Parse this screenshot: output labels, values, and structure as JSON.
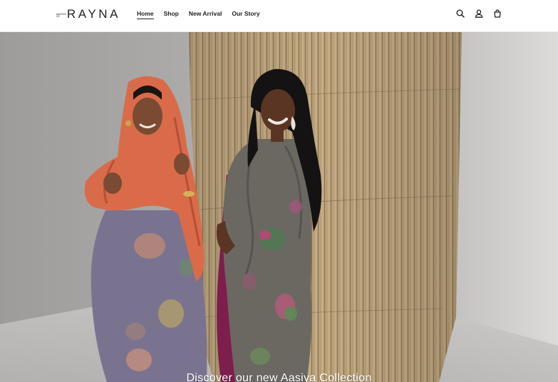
{
  "brand": {
    "name": "RAYNA",
    "sub_top": "MAISON",
    "sub_bottom": "DE"
  },
  "nav": [
    {
      "label": "Home",
      "active": true
    },
    {
      "label": "Shop",
      "active": false
    },
    {
      "label": "New Arrival",
      "active": false
    },
    {
      "label": "Our Story",
      "active": false
    }
  ],
  "icons": [
    "search-icon",
    "account-icon",
    "cart-icon"
  ],
  "hero": {
    "caption": "Discover our new Aasiya Collection"
  },
  "colors": {
    "text": "#1f1f1f",
    "header_bg": "#ffffff",
    "hero_bg": "#c4c2c1"
  }
}
